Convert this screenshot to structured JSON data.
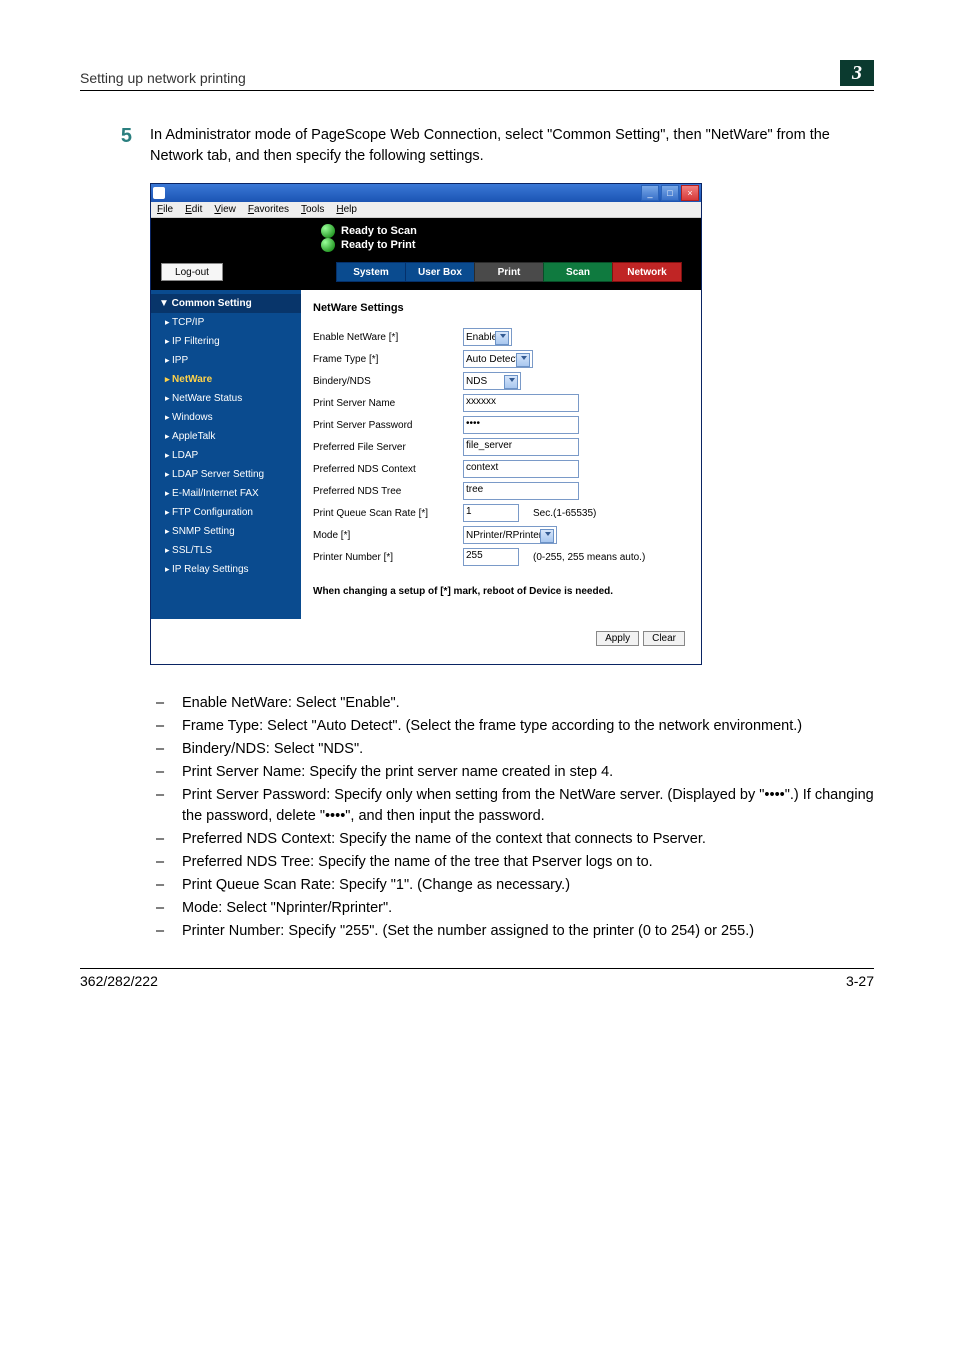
{
  "header": {
    "title": "Setting up network printing",
    "chapter": "3"
  },
  "step": {
    "number": "5",
    "text": "In Administrator mode of PageScope Web Connection, select \"Common Setting\", then \"NetWare\" from the Network tab, and then specify the following settings."
  },
  "window": {
    "menu": [
      "File",
      "Edit",
      "View",
      "Favorites",
      "Tools",
      "Help"
    ],
    "ready1": "Ready to Scan",
    "ready2": "Ready to Print",
    "logout": "Log-out",
    "tabs": [
      "System",
      "User Box",
      "Print",
      "Scan",
      "Network"
    ],
    "sidebar": {
      "head": "▼ Common Setting",
      "items": [
        "TCP/IP",
        "IP Filtering",
        "IPP",
        "NetWare",
        "NetWare Status",
        "Windows",
        "AppleTalk",
        "LDAP",
        "LDAP Server Setting",
        "E-Mail/Internet FAX",
        "FTP Configuration",
        "SNMP Setting",
        "SSL/TLS",
        "IP Relay Settings"
      ]
    },
    "main": {
      "title": "NetWare Settings",
      "rows": {
        "enable_label": "Enable NetWare [*]",
        "enable_val": "Enable",
        "frame_label": "Frame Type [*]",
        "frame_val": "Auto Detect",
        "bindery_label": "Bindery/NDS",
        "bindery_val": "NDS",
        "psname_label": "Print Server Name",
        "psname_val": "xxxxxx",
        "pspass_label": "Print Server Password",
        "pspass_val": "••••",
        "pfs_label": "Preferred File Server",
        "pfs_val": "file_server",
        "pctx_label": "Preferred NDS Context",
        "pctx_val": "context",
        "ptree_label": "Preferred NDS Tree",
        "ptree_val": "tree",
        "pq_label": "Print Queue Scan Rate [*]",
        "pq_val": "1",
        "pq_suffix": "Sec.(1-65535)",
        "mode_label": "Mode [*]",
        "mode_val": "NPrinter/RPrinter",
        "pn_label": "Printer Number [*]",
        "pn_val": "255",
        "pn_suffix": "(0-255, 255 means auto.)"
      },
      "note": "When changing a setup of [*] mark, reboot of Device is needed.",
      "apply": "Apply",
      "clear": "Clear"
    }
  },
  "bullets": [
    "Enable NetWare: Select \"Enable\".",
    "Frame Type: Select \"Auto Detect\". (Select the frame type according to the network environment.)",
    "Bindery/NDS: Select \"NDS\".",
    "Print Server Name: Specify the print server name created in step 4.",
    "Print Server Password: Specify only when setting from the NetWare server. (Displayed by \"••••\".) If changing the password, delete \"••••\", and then input the password.",
    "Preferred NDS Context: Specify the name of the context that connects to Pserver.",
    "Preferred NDS Tree: Specify the name of the tree that Pserver logs on to.",
    "Print Queue Scan Rate: Specify \"1\". (Change as necessary.)",
    "Mode: Select \"Nprinter/Rprinter\".",
    "Printer Number: Specify \"255\". (Set the number assigned to the printer (0 to 254) or 255.)"
  ],
  "footer": {
    "left": "362/282/222",
    "right": "3-27"
  },
  "chart_data": {
    "type": "table",
    "title": "NetWare Settings",
    "rows": [
      {
        "field": "Enable NetWare [*]",
        "value": "Enable",
        "control": "select"
      },
      {
        "field": "Frame Type [*]",
        "value": "Auto Detect",
        "control": "select"
      },
      {
        "field": "Bindery/NDS",
        "value": "NDS",
        "control": "select"
      },
      {
        "field": "Print Server Name",
        "value": "xxxxxx",
        "control": "text"
      },
      {
        "field": "Print Server Password",
        "value": "••••",
        "control": "password"
      },
      {
        "field": "Preferred File Server",
        "value": "file_server",
        "control": "text"
      },
      {
        "field": "Preferred NDS Context",
        "value": "context",
        "control": "text"
      },
      {
        "field": "Preferred NDS Tree",
        "value": "tree",
        "control": "text"
      },
      {
        "field": "Print Queue Scan Rate [*]",
        "value": "1",
        "suffix": "Sec.(1-65535)",
        "control": "text"
      },
      {
        "field": "Mode [*]",
        "value": "NPrinter/RPrinter",
        "control": "select"
      },
      {
        "field": "Printer Number [*]",
        "value": "255",
        "suffix": "(0-255, 255 means auto.)",
        "control": "text"
      }
    ]
  }
}
